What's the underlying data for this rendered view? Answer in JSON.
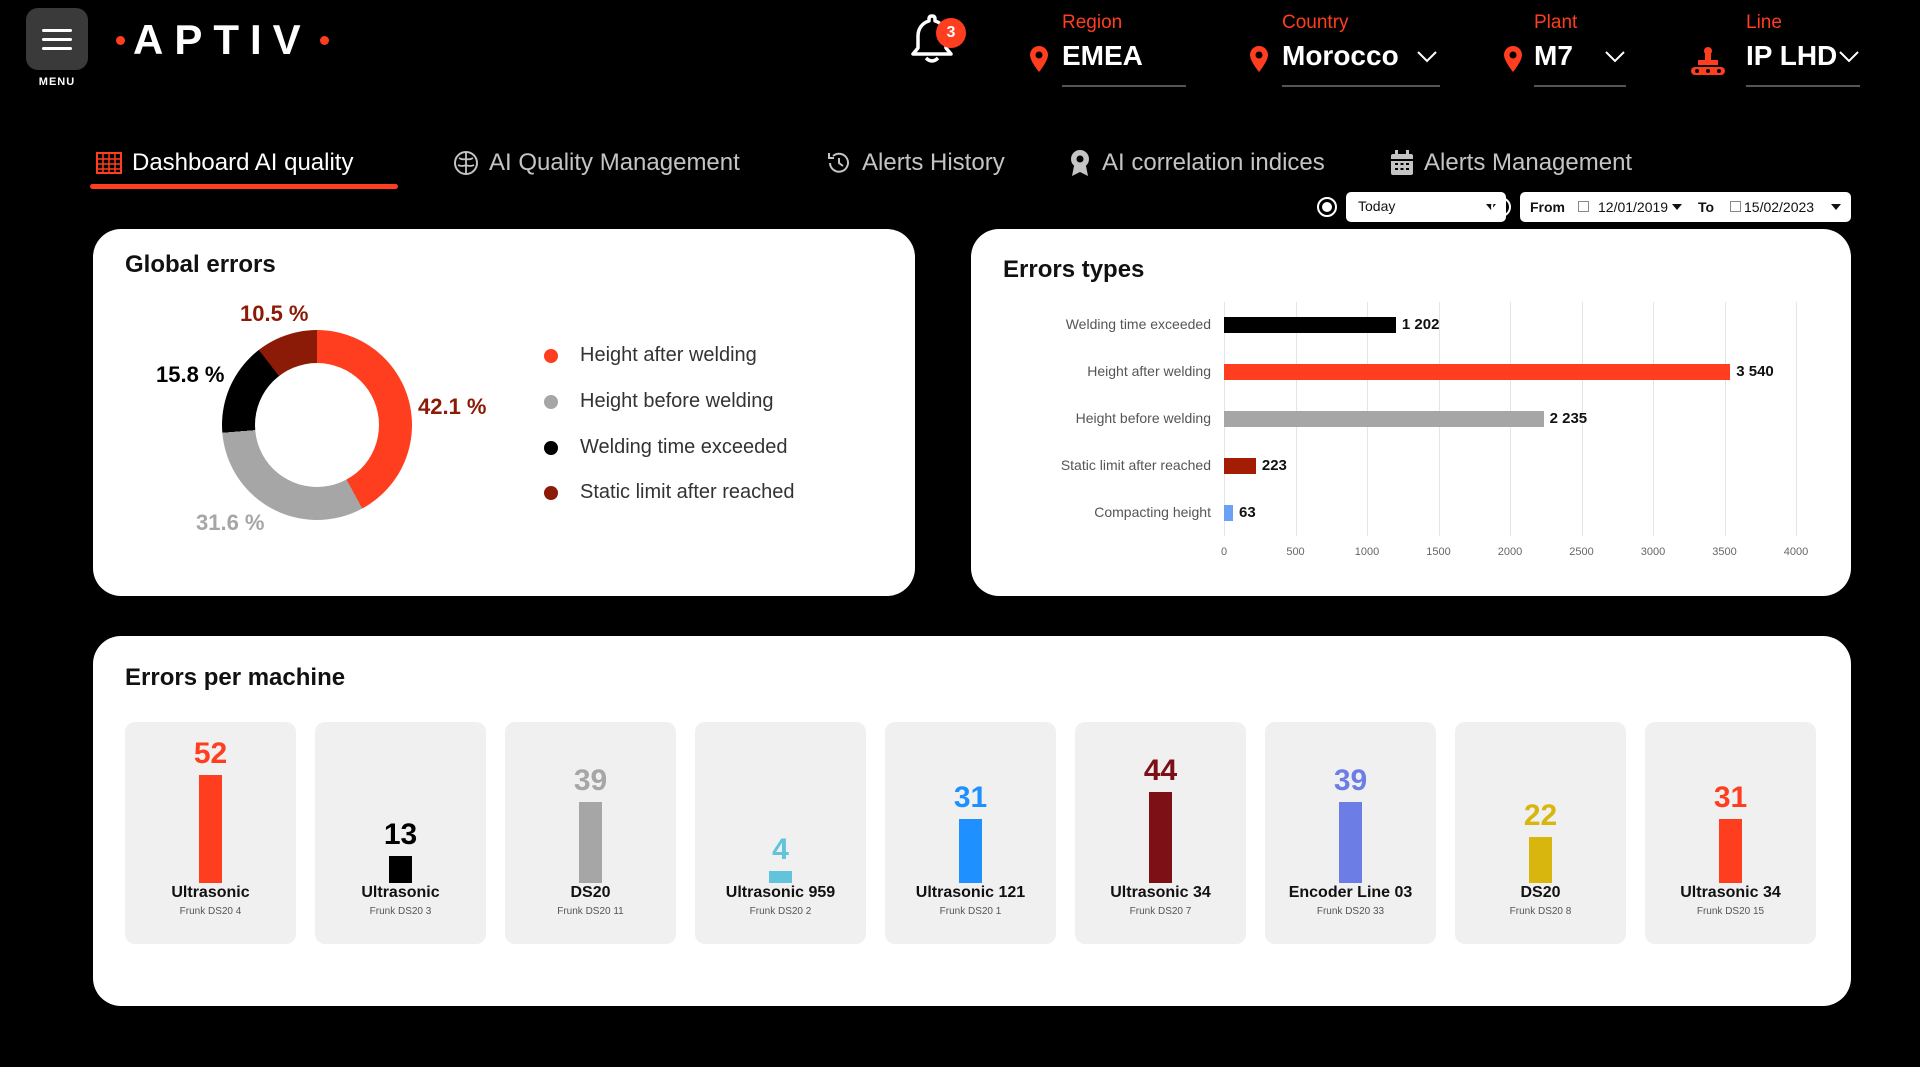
{
  "header": {
    "menu_label": "MENU",
    "logo_text": "APTIV",
    "notifications_count": "3",
    "region": {
      "caption": "Region",
      "value": "EMEA"
    },
    "country": {
      "caption": "Country",
      "value": "Morocco"
    },
    "plant": {
      "caption": "Plant",
      "value": "M7"
    },
    "line": {
      "caption": "Line",
      "value": "IP LHD"
    }
  },
  "tabs": [
    {
      "label": "Dashboard AI quality",
      "icon": "table-icon",
      "active": true
    },
    {
      "label": "AI Quality Management",
      "icon": "brain-icon",
      "active": false
    },
    {
      "label": "Alerts History",
      "icon": "history-icon",
      "active": false
    },
    {
      "label": "AI correlation indices",
      "icon": "badge-gear-icon",
      "active": false
    },
    {
      "label": "Alerts Management",
      "icon": "calendar-icon",
      "active": false
    }
  ],
  "filters": {
    "period_value": "Today",
    "from_label": "From",
    "from_date": "12/01/2019",
    "to_label": "To",
    "to_date": "15/02/2023"
  },
  "global_errors": {
    "title": "Global errors",
    "segments": [
      {
        "label": "Height after welding",
        "percent_text": "42.1 %",
        "value": 42.1,
        "color": "#ff3d1f"
      },
      {
        "label": "Height before welding",
        "percent_text": "31.6 %",
        "value": 31.6,
        "color": "#a6a6a6"
      },
      {
        "label": "Welding time exceeded",
        "percent_text": "15.8 %",
        "value": 15.8,
        "color": "#000000"
      },
      {
        "label": "Static limit after reached",
        "percent_text": "10.5 %",
        "value": 10.5,
        "color": "#8b1a06"
      }
    ]
  },
  "errors_types": {
    "title": "Errors types",
    "chart_data": {
      "type": "bar",
      "orientation": "horizontal",
      "categories": [
        "Welding time exceeded",
        "Height after welding",
        "Height before welding",
        "Static limit after reached",
        "Compacting height"
      ],
      "values": [
        1202,
        3540,
        2235,
        223,
        63
      ],
      "value_labels": [
        "1 202",
        "3 540",
        "2 235",
        "223",
        "63"
      ],
      "colors": [
        "#000000",
        "#ff3d1f",
        "#a6a6a6",
        "#a31d05",
        "#6aa0f5"
      ],
      "xlim": [
        0,
        4000
      ],
      "xticks": [
        "0",
        "500",
        "1000",
        "1500",
        "2000",
        "2500",
        "3000",
        "3500",
        "4000"
      ],
      "grid": true
    }
  },
  "errors_per_machine": {
    "title": "Errors per machine",
    "machines": [
      {
        "name": "Ultrasonic",
        "sub": "Frunk DS20 4",
        "value": 52,
        "color": "#ff3d1f"
      },
      {
        "name": "Ultrasonic",
        "sub": "Frunk DS20 3",
        "value": 13,
        "color": "#000000"
      },
      {
        "name": "DS20",
        "sub": "Frunk DS20 11",
        "value": 39,
        "color": "#a6a6a6"
      },
      {
        "name": "Ultrasonic 959",
        "sub": "Frunk DS20 2",
        "value": 4,
        "color": "#62c3dc"
      },
      {
        "name": "Ultrasonic 121",
        "sub": "Frunk DS20 1",
        "value": 31,
        "color": "#1e90ff"
      },
      {
        "name": "Ultrasonic 34",
        "sub": "Frunk DS20 7",
        "value": 44,
        "color": "#7d0f16"
      },
      {
        "name": "Encoder Line 03",
        "sub": "Frunk DS20 33",
        "value": 39,
        "color": "#6c7de6"
      },
      {
        "name": "DS20",
        "sub": "Frunk DS20 8",
        "value": 22,
        "color": "#d8b60e"
      },
      {
        "name": "Ultrasonic 34",
        "sub": "Frunk DS20 15",
        "value": 31,
        "color": "#ff3d1f"
      }
    ]
  }
}
